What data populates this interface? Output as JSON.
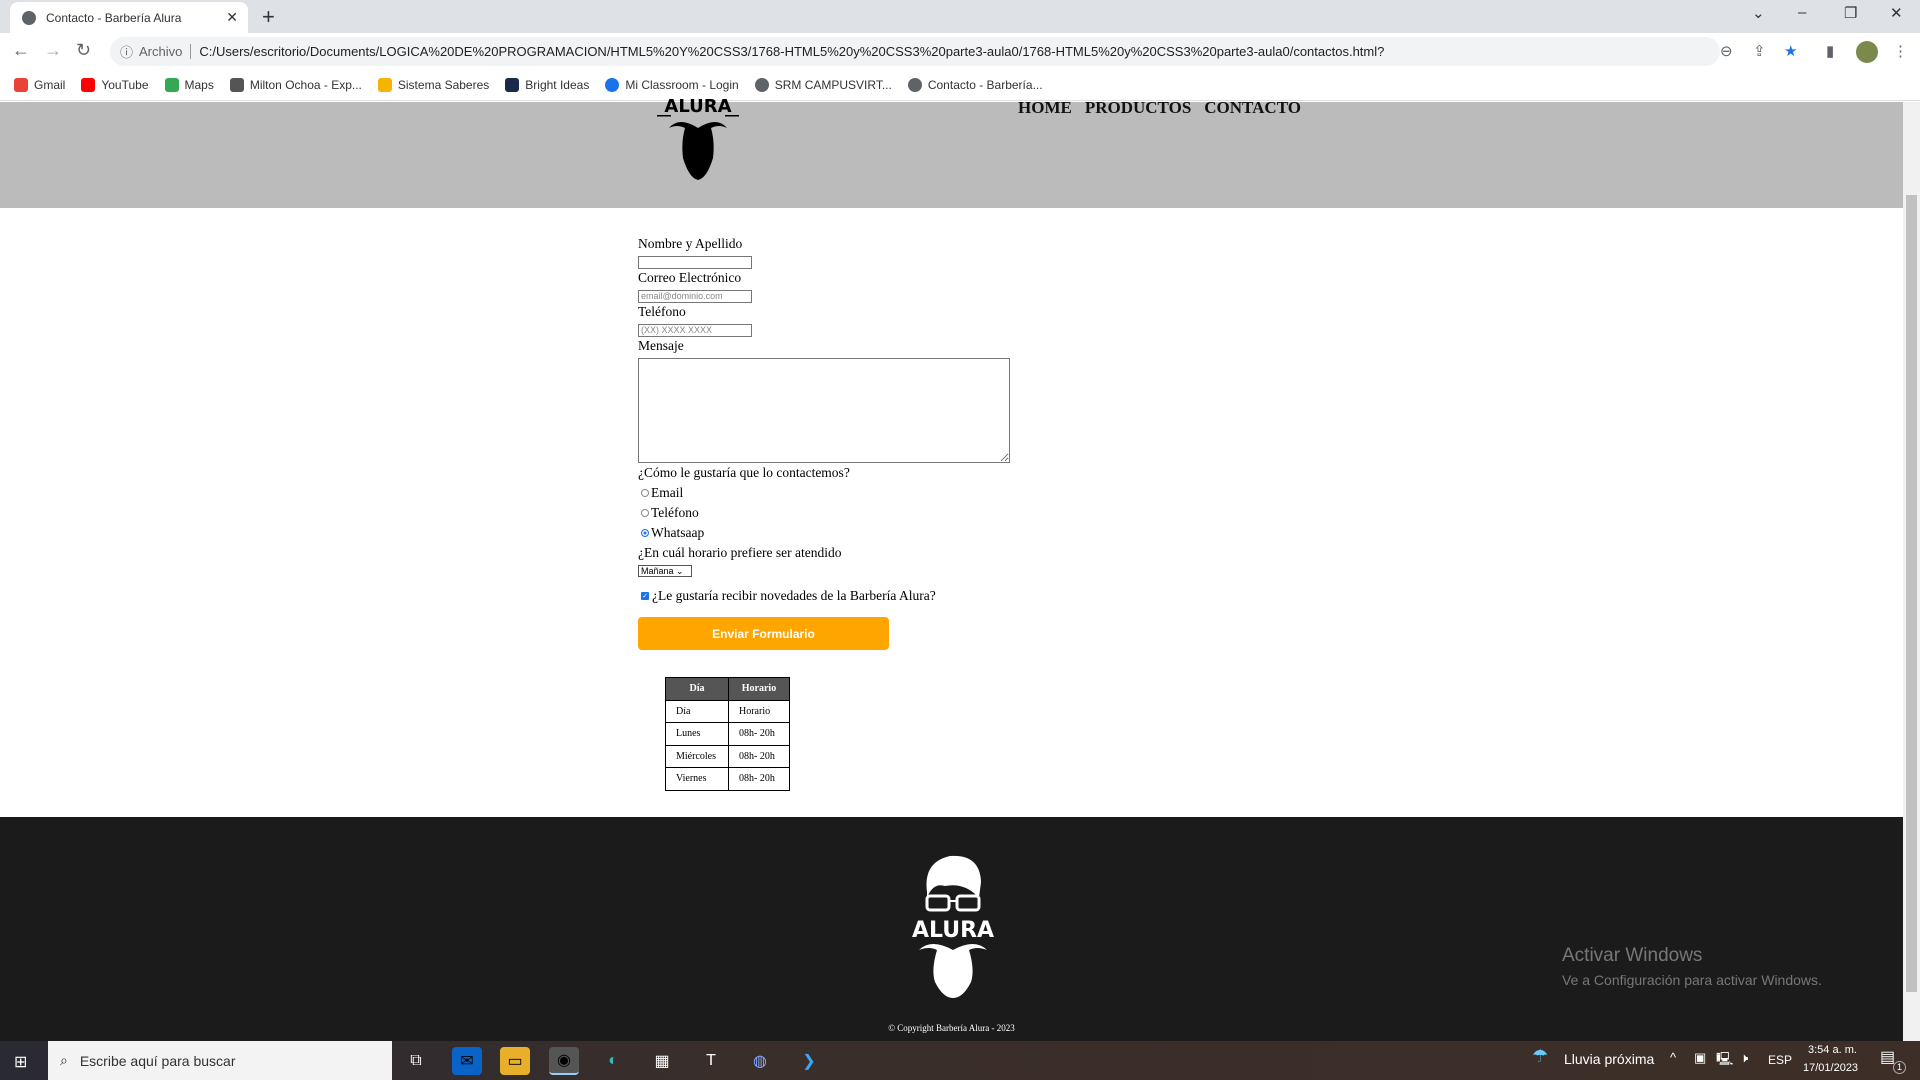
{
  "browser": {
    "tab_title": "Contacto - Barbería Alura",
    "url_scheme_label": "Archivo",
    "url": "C:/Users/escritorio/Documents/LOGICA%20DE%20PROGRAMACION/HTML5%20Y%20CSS3/1768-HTML5%20y%20CSS3%20parte3-aula0/1768-HTML5%20y%20CSS3%20parte3-aula0/contactos.html?",
    "bookmarks": [
      {
        "label": "Gmail",
        "color": "#ea4335"
      },
      {
        "label": "YouTube",
        "color": "#ff0000"
      },
      {
        "label": "Maps",
        "color": "#34a853"
      },
      {
        "label": "Milton Ochoa - Exp...",
        "color": "#555555"
      },
      {
        "label": "Sistema Saberes",
        "color": "#f4b400"
      },
      {
        "label": "Bright Ideas",
        "color": "#1a2a4a"
      },
      {
        "label": "Mi Classroom - Login",
        "color": "#1a73e8"
      },
      {
        "label": "SRM CAMPUSVIRT...",
        "color": "#5f6368"
      },
      {
        "label": "Contacto - Barbería...",
        "color": "#5f6368"
      }
    ]
  },
  "header": {
    "logo_text": "ALURA",
    "nav": [
      "HOME",
      "PRODUCTOS",
      "CONTACTO"
    ]
  },
  "form": {
    "name_label": "Nombre y Apellido",
    "name_value": "",
    "email_label": "Correo Electrónico",
    "email_placeholder": "email@dominio.com",
    "phone_label": "Teléfono",
    "phone_placeholder": "(XX) XXXX XXXX",
    "message_label": "Mensaje",
    "contact_question": "¿Cómo le gustaría que lo contactemos?",
    "contact_options": [
      {
        "label": "Email",
        "selected": false
      },
      {
        "label": "Teléfono",
        "selected": false
      },
      {
        "label": "Whatsaap",
        "selected": true
      }
    ],
    "schedule_question": "¿En cuál horario prefiere ser atendido",
    "schedule_value": "Mañana",
    "newsletter_label": "¿Le gustaría recibir novedades de la Barbería Alura?",
    "newsletter_checked": true,
    "submit_label": "Enviar Formulario",
    "submit_color": "#ffa500"
  },
  "schedule_table": {
    "headers": [
      "Día",
      "Horario"
    ],
    "rows": [
      [
        "Día",
        "Horario"
      ],
      [
        "Lunes",
        "08h- 20h"
      ],
      [
        "Miércoles",
        "08h- 20h"
      ],
      [
        "Viernes",
        "08h- 20h"
      ]
    ]
  },
  "footer": {
    "copyright": "© Copyright Barbería Alura - 2023"
  },
  "watermark": {
    "title": "Activar Windows",
    "subtitle": "Ve a Configuración para activar Windows."
  },
  "taskbar": {
    "search_placeholder": "Escribe aquí para buscar",
    "weather": "Lluvia próxima",
    "language": "ESP",
    "time": "3:54 a. m.",
    "date": "17/01/2023",
    "notifications": "1"
  }
}
